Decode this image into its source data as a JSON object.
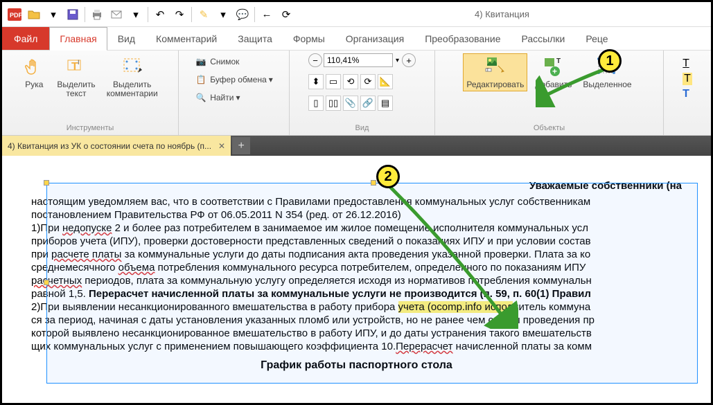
{
  "qat_title": "4) Квитанция",
  "tabs": {
    "file": "Файл",
    "items": [
      "Главная",
      "Вид",
      "Комментарий",
      "Защита",
      "Формы",
      "Организация",
      "Преобразование",
      "Рассылки",
      "Реце"
    ],
    "active_index": 0
  },
  "ribbon": {
    "tools_group": "Инструменты",
    "hand": "Рука",
    "select_text": "Выделить\nтекст",
    "select_comments": "Выделить\nкомментарии",
    "snapshot": "Снимок",
    "clipboard": "Буфер обмена",
    "find": "Найти",
    "view_group": "Вид",
    "zoom_value": "110,41%",
    "objects_group": "Объекты",
    "edit": "Редактировать",
    "add": "Добавить",
    "selected": "Выделенное"
  },
  "doc_tab": "4) Квитанция из УК о состоянии счета по ноябрь (п...",
  "doc": {
    "header": "Уважаемые собственники (на",
    "l1a": "настоящим уведомляем вас, что в соответствии с Правилами предоставления коммунальных услуг собственникам",
    "l1b": "постановлением Правительства РФ от 06.05.2011 N 354 (ред. от 26.12.2016)",
    "l2a": "1)При ",
    "l2b": "недопуске",
    "l2c": " 2 и более раз потребителем в занимаемое им жилое помещение исполнителя коммунальных усл",
    "l3": "приборов учета (ИПУ), проверки достоверности представленных сведений о показаниях ИПУ и при условии состав",
    "l4a": "при ",
    "l4b": "расчете платы",
    "l4c": " за коммунальные услуги до даты подписания акта проведения указанной проверки. Плата за ко",
    "l5a": "среднемесячного ",
    "l5b": "объема",
    "l5c": " потребления коммунального ресурса потребителем, определенного по показаниям ИПУ ",
    "l6a": "расчетных",
    "l6b": " периодов, плата за коммунальную услугу определяется исходя из нормативов потребления коммунальн",
    "l7a": "равной 1,5. ",
    "l7b": "Перерасчет начисленной платы за коммунальные услуги не производится (п. 59, п. 60(1) Правил",
    "l8a": "2)При выявлении несанкционированного вмешательства в работу прибора ",
    "l8hl": "учета (ocomp.info испол",
    "l8b": "нитель коммуна",
    "l9": "ся за период, начиная с даты установления указанных пломб или устройств, но не ранее чем с даты проведения пр",
    "l10a": "которой выявлено несанкционированное вмешательство в работу ИПУ, и до даты устранения такого вмешательств",
    "l11a": "щих коммунальных услуг с применением повышающего коэффициента 10.",
    "l11b": "Перерасчет",
    "l11c": " начисленной платы за комм",
    "footer": "График работы паспортного стола"
  },
  "callouts": {
    "one": "1",
    "two": "2"
  }
}
